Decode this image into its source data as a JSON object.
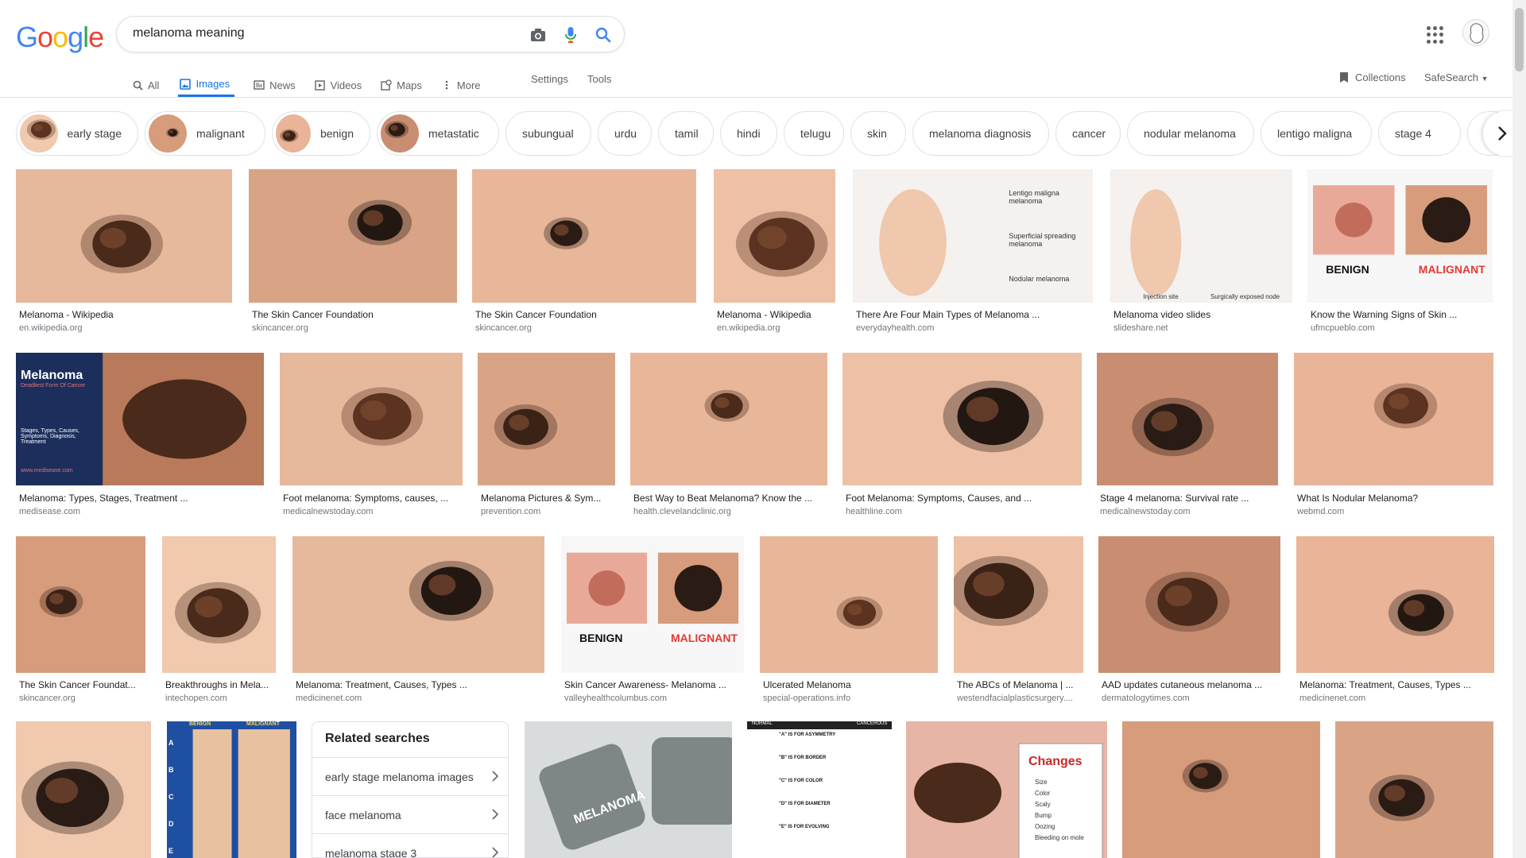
{
  "colors": {
    "accent": "#1a73e8",
    "logo": [
      "#4285f4",
      "#ea4335",
      "#fbbc05",
      "#4285f4",
      "#34a853",
      "#ea4335"
    ]
  },
  "logo": {
    "letters": [
      "G",
      "o",
      "o",
      "g",
      "l",
      "e"
    ]
  },
  "search": {
    "query": "melanoma meaning"
  },
  "tabs": [
    {
      "label": "All",
      "icon": "search-icon"
    },
    {
      "label": "Images",
      "icon": "image-icon"
    },
    {
      "label": "News",
      "icon": "news-icon"
    },
    {
      "label": "Videos",
      "icon": "video-icon"
    },
    {
      "label": "Maps",
      "icon": "map-icon"
    },
    {
      "label": "More",
      "icon": "more-vert-icon"
    }
  ],
  "tools": {
    "settings": "Settings",
    "tools": "Tools"
  },
  "collections": {
    "label": "Collections"
  },
  "safesearch": {
    "label": "SafeSearch"
  },
  "chips": [
    {
      "label": "early stage",
      "thumb": true
    },
    {
      "label": "malignant",
      "thumb": true
    },
    {
      "label": "benign",
      "thumb": true
    },
    {
      "label": "metastatic",
      "thumb": true
    },
    {
      "label": "subungual",
      "thumb": false
    },
    {
      "label": "urdu",
      "thumb": false
    },
    {
      "label": "tamil",
      "thumb": false
    },
    {
      "label": "hindi",
      "thumb": false
    },
    {
      "label": "telugu",
      "thumb": false
    },
    {
      "label": "skin",
      "thumb": false
    },
    {
      "label": "melanoma diagnosis",
      "thumb": false
    },
    {
      "label": "cancer",
      "thumb": false
    },
    {
      "label": "nodular melanoma",
      "thumb": false
    },
    {
      "label": "lentigo maligna",
      "thumb": false
    },
    {
      "label": "stage 4",
      "thumb": false
    },
    {
      "label": "su",
      "thumb": false
    }
  ],
  "results": [
    {
      "title": "Melanoma - Wikipedia",
      "source": "en.wikipedia.org"
    },
    {
      "title": "The Skin Cancer Foundation",
      "source": "skincancer.org"
    },
    {
      "title": "The Skin Cancer Foundation",
      "source": "skincancer.org"
    },
    {
      "title": "Melanoma - Wikipedia",
      "source": "en.wikipedia.org"
    },
    {
      "title": "There Are Four Main Types of Melanoma ...",
      "source": "everydayhealth.com",
      "labels": [
        "Lentigo maligna melanoma",
        "Superficial spreading melanoma",
        "Nodular melanoma"
      ]
    },
    {
      "title": "Melanoma video slides",
      "source": "slideshare.net",
      "labels": [
        "Injection site",
        "Surgically exposed node"
      ]
    },
    {
      "title": "Know the Warning Signs of Skin ...",
      "source": "ufmcpueblo.com",
      "labels": [
        "BENIGN",
        "MALIGNANT"
      ]
    },
    {
      "title": "Melanoma: Types, Stages, Treatment ...",
      "source": "medisease.com",
      "labels": [
        "Melanoma",
        "Deadliest Form Of Cancer",
        "Stages, Types, Causes, Symptoms, Diagnosis, Treatment",
        "www.medisease.com"
      ]
    },
    {
      "title": "Foot melanoma: Symptoms, causes, ...",
      "source": "medicalnewstoday.com"
    },
    {
      "title": "Melanoma Pictures & Sym...",
      "source": "prevention.com"
    },
    {
      "title": "Best Way to Beat Melanoma? Know the ...",
      "source": "health.clevelandclinic.org"
    },
    {
      "title": "Foot Melanoma: Symptoms, Causes, and ...",
      "source": "healthline.com"
    },
    {
      "title": "Stage 4 melanoma: Survival rate ...",
      "source": "medicalnewstoday.com"
    },
    {
      "title": "What Is Nodular Melanoma?",
      "source": "webmd.com"
    },
    {
      "title": "The Skin Cancer Foundat...",
      "source": "skincancer.org"
    },
    {
      "title": "Breakthroughs in Mela...",
      "source": "intechopen.com"
    },
    {
      "title": "Melanoma: Treatment, Causes, Types ...",
      "source": "medicinenet.com"
    },
    {
      "title": "Skin Cancer Awareness- Melanoma ...",
      "source": "valleyhealthcolumbus.com",
      "labels": [
        "BENIGN",
        "MALIGNANT"
      ]
    },
    {
      "title": "Ulcerated Melanoma",
      "source": "special-operations.info"
    },
    {
      "title": "The ABCs of Melanoma | ...",
      "source": "westendfacialplasticsurgery...."
    },
    {
      "title": "AAD updates cutaneous melanoma ...",
      "source": "dermatologytimes.com"
    },
    {
      "title": "Melanoma: Treatment, Causes, Types ...",
      "source": "medicinenet.com"
    }
  ],
  "row4_labels": {
    "chart": [
      "BENIGN",
      "MALIGNANT",
      "A",
      "B",
      "C",
      "D",
      "E"
    ],
    "keyboard": [
      "MELANOMA"
    ],
    "abcde": [
      "NORMAL",
      "CANCEROUS",
      "\"A\" IS FOR ASYMMETRY",
      "\"B\" IS FOR BORDER",
      "\"C\" IS FOR COLOR",
      "\"D\" IS FOR DIAMETER",
      "\"E\" IS FOR EVOLVING"
    ],
    "changes_title": "Changes",
    "changes_items": [
      "Size",
      "Color",
      "Scaly",
      "Bump",
      "Oozing",
      "Bleeding on mole"
    ]
  },
  "related": {
    "title": "Related searches",
    "items": [
      "early stage melanoma images",
      "face melanoma",
      "melanoma stage 3"
    ]
  }
}
